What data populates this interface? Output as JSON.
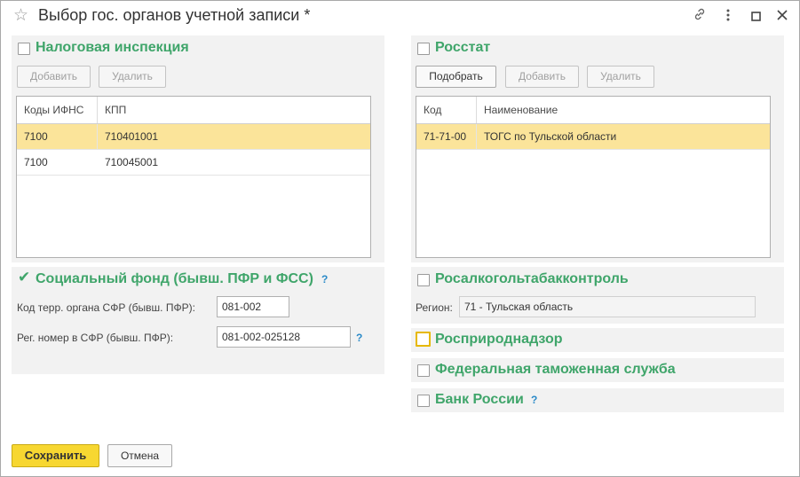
{
  "window": {
    "title": "Выбор гос. органов учетной записи *",
    "icons": [
      "star-icon",
      "link-icon",
      "more-icon",
      "maximize-icon",
      "close-icon"
    ]
  },
  "tax": {
    "title": "Налоговая инспекция",
    "checked": false,
    "add_label": "Добавить",
    "delete_label": "Удалить",
    "columns": [
      "Коды ИФНС",
      "КПП"
    ],
    "rows": [
      {
        "code": "7100",
        "kpp": "710401001",
        "selected": true
      },
      {
        "code": "7100",
        "kpp": "710045001",
        "selected": false
      }
    ]
  },
  "rosstat": {
    "title": "Росстат",
    "checked": false,
    "pick_label": "Подобрать",
    "add_label": "Добавить",
    "delete_label": "Удалить",
    "columns": [
      "Код",
      "Наименование"
    ],
    "rows": [
      {
        "code": "71-71-00",
        "name": "ТОГС по Тульской области",
        "selected": true
      }
    ]
  },
  "social": {
    "title": "Социальный фонд (бывш. ПФР и ФСС)",
    "checked": true,
    "help": "?",
    "terr_label": "Код терр. органа СФР (бывш. ПФР):",
    "terr_value": "081-002",
    "reg_label": "Рег. номер в СФР (бывш. ПФР):",
    "reg_value": "081-002-025128",
    "reg_help": "?"
  },
  "rosalko": {
    "title": "Росалкогольтабакконтроль",
    "checked": false,
    "region_label": "Регион:",
    "region_value": "71 - Тульская область"
  },
  "rosprirod": {
    "title": "Росприроднадзор",
    "checked": false
  },
  "customs": {
    "title": "Федеральная таможенная служба",
    "checked": false
  },
  "bank": {
    "title": "Банк России",
    "checked": false,
    "help": "?"
  },
  "footer": {
    "save_label": "Сохранить",
    "cancel_label": "Отмена"
  },
  "colors": {
    "accent_green": "#3fa56a",
    "selected_row": "#fbe49a",
    "save_yellow": "#f7d731",
    "help_blue": "#2a8ac8"
  }
}
